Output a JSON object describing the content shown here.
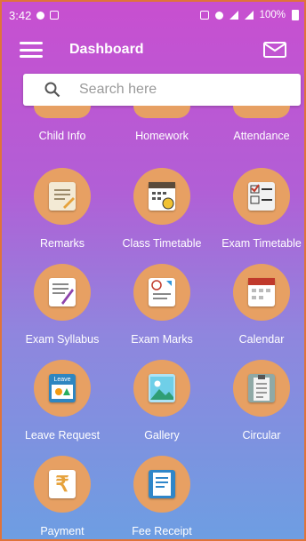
{
  "status_bar": {
    "time": "3:42",
    "battery": "100%"
  },
  "header": {
    "title": "Dashboard",
    "menu_icon": "hamburger-icon",
    "mail_icon": "mail-icon"
  },
  "search": {
    "placeholder": "Search here",
    "icon": "search-icon"
  },
  "colors": {
    "gradient_top": "#c84fd0",
    "gradient_bottom": "#6d9ee2",
    "tile_circle": "#e7a063",
    "frame": "#e0733a"
  },
  "grid": {
    "partial_row": [
      "Child Info",
      "Homework",
      "Attendance"
    ],
    "rows": [
      [
        {
          "label": "Remarks",
          "icon": "remarks-icon"
        },
        {
          "label": "Class Timetable",
          "icon": "class-timetable-icon"
        },
        {
          "label": "Exam Timetable",
          "icon": "exam-timetable-icon"
        }
      ],
      [
        {
          "label": "Exam Syllabus",
          "icon": "exam-syllabus-icon"
        },
        {
          "label": "Exam Marks",
          "icon": "exam-marks-icon"
        },
        {
          "label": "Calendar",
          "icon": "calendar-icon"
        }
      ],
      [
        {
          "label": "Leave Request",
          "icon": "leave-request-icon",
          "badge": "Leave"
        },
        {
          "label": "Gallery",
          "icon": "gallery-icon"
        },
        {
          "label": "Circular",
          "icon": "circular-icon"
        }
      ],
      [
        {
          "label": "Payment",
          "icon": "payment-icon",
          "glyph": "₹"
        },
        {
          "label": "Fee Receipt",
          "icon": "fee-receipt-icon"
        }
      ]
    ]
  }
}
